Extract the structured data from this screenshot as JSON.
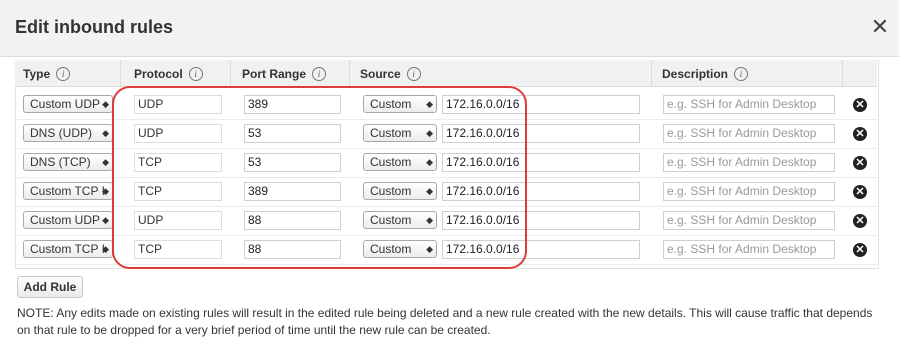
{
  "dialog": {
    "title": "Edit inbound rules",
    "close_glyph": "✕"
  },
  "columns": {
    "type": "Type",
    "protocol": "Protocol",
    "port_range": "Port Range",
    "source": "Source",
    "description": "Description",
    "info_glyph": "i"
  },
  "rows": [
    {
      "type": "Custom UDP",
      "protocol": "UDP",
      "port": "389",
      "source_mode": "Custom",
      "cidr": "172.16.0.0/16"
    },
    {
      "type": "DNS (UDP)",
      "protocol": "UDP",
      "port": "53",
      "source_mode": "Custom",
      "cidr": "172.16.0.0/16"
    },
    {
      "type": "DNS (TCP)",
      "protocol": "TCP",
      "port": "53",
      "source_mode": "Custom",
      "cidr": "172.16.0.0/16"
    },
    {
      "type": "Custom TCP I",
      "protocol": "TCP",
      "port": "389",
      "source_mode": "Custom",
      "cidr": "172.16.0.0/16"
    },
    {
      "type": "Custom UDP",
      "protocol": "UDP",
      "port": "88",
      "source_mode": "Custom",
      "cidr": "172.16.0.0/16"
    },
    {
      "type": "Custom TCP I",
      "protocol": "TCP",
      "port": "88",
      "source_mode": "Custom",
      "cidr": "172.16.0.0/16"
    }
  ],
  "description_placeholder": "e.g. SSH for Admin Desktop",
  "delete_glyph": "✕",
  "select_arrow": "◆",
  "add_rule_label": "Add Rule",
  "note": "NOTE: Any edits made on existing rules will result in the edited rule being deleted and a new rule created with the new details. This will cause traffic that depends on that rule to be dropped for a very brief period of time until the new rule can be created.",
  "colors": {
    "highlight": "#e03a3a",
    "header_bg": "#f2f2f2",
    "table_header_bg": "#f1f1f1"
  }
}
